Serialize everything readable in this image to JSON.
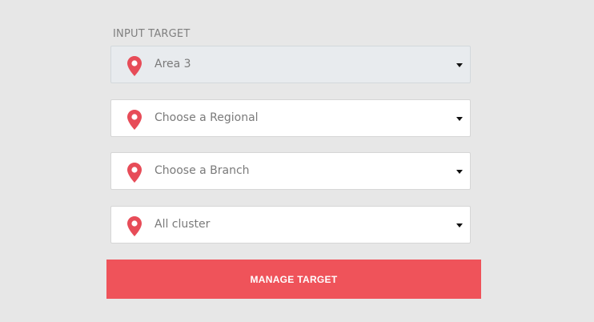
{
  "colors": {
    "page_background": "#e7e7e7",
    "accent": "#ef535a",
    "pin": "#e74c58",
    "disabled_field": "#e8ebee"
  },
  "form": {
    "section_label": "INPUT TARGET",
    "fields": [
      {
        "value": "Area 3",
        "icon": "map-pin-icon",
        "state": "disabled"
      },
      {
        "value": "Choose a Regional",
        "icon": "map-pin-icon",
        "state": "enabled"
      },
      {
        "value": "Choose a Branch",
        "icon": "map-pin-icon",
        "state": "enabled"
      },
      {
        "value": "All cluster",
        "icon": "map-pin-icon",
        "state": "enabled"
      }
    ],
    "submit_label": "MANAGE TARGET"
  }
}
